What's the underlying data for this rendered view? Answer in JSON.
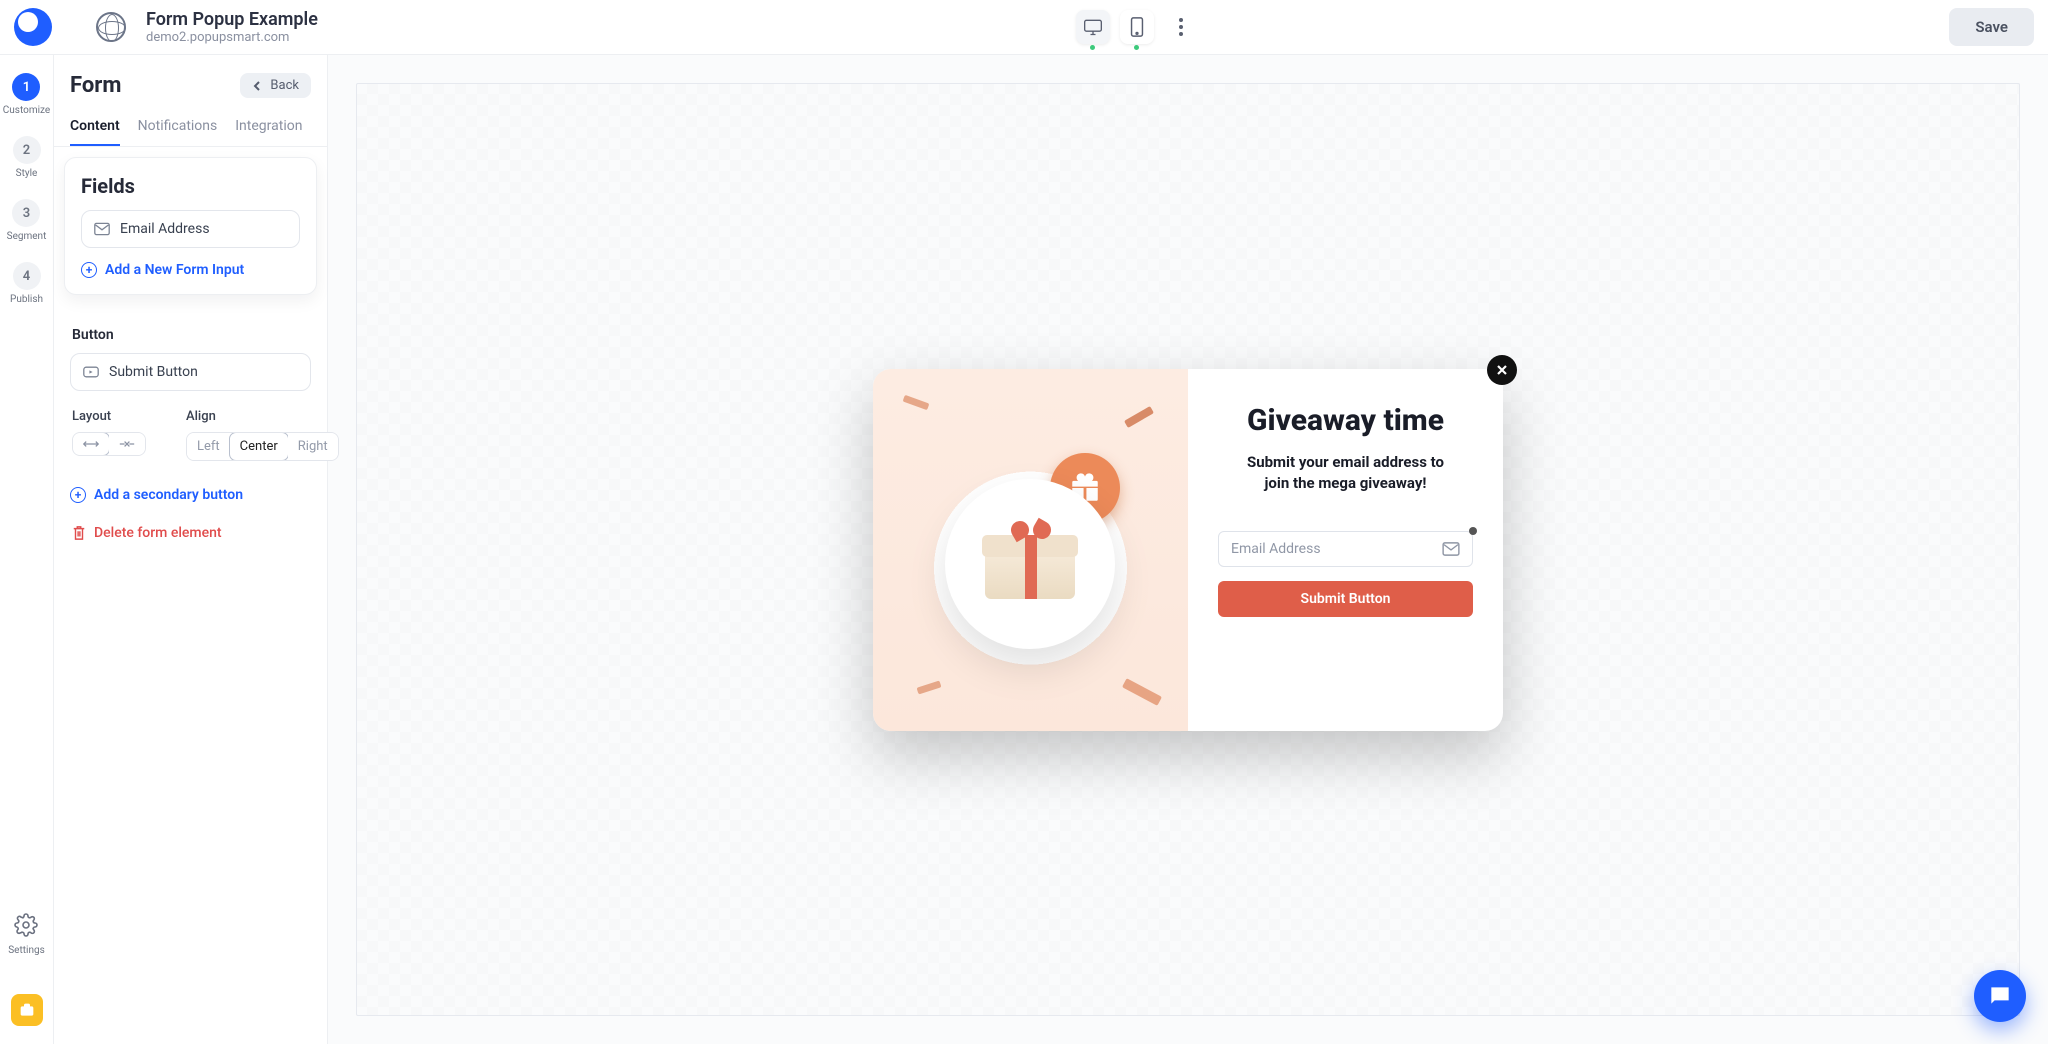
{
  "brand": {
    "color": "#1f5eff"
  },
  "header": {
    "title": "Form Popup Example",
    "subtitle": "demo2.popupsmart.com",
    "save_label": "Save",
    "device_desktop_active": true,
    "device_mobile_active": false
  },
  "steps": [
    {
      "num": "1",
      "label": "Customize",
      "active": true
    },
    {
      "num": "2",
      "label": "Style",
      "active": false
    },
    {
      "num": "3",
      "label": "Segment",
      "active": false
    },
    {
      "num": "4",
      "label": "Publish",
      "active": false
    }
  ],
  "settings_label": "Settings",
  "panel": {
    "title": "Form",
    "back_label": "Back",
    "tabs": [
      {
        "label": "Content",
        "active": true
      },
      {
        "label": "Notifications",
        "active": false
      },
      {
        "label": "Integration",
        "active": false
      }
    ],
    "fields_title": "Fields",
    "fields": [
      {
        "label": "Email Address",
        "icon": "mail-icon"
      }
    ],
    "add_input_label": "Add a New Form Input",
    "button_title": "Button",
    "button_field_label": "Submit Button",
    "layout_label": "Layout",
    "align_label": "Align",
    "align_options": {
      "left": "Left",
      "center": "Center",
      "right": "Right"
    },
    "align_selected": "center",
    "add_secondary_label": "Add a secondary button",
    "delete_label": "Delete form element"
  },
  "popup": {
    "headline": "Giveaway time",
    "subtext_line1": "Submit your email address to",
    "subtext_line2": "join the mega giveaway!",
    "email_placeholder": "Email Address",
    "submit_label": "Submit Button"
  },
  "colors": {
    "accent": "#1f5eff",
    "danger": "#e04c4c",
    "popup_button": "#df5e49",
    "success_dot": "#3cc97b"
  }
}
